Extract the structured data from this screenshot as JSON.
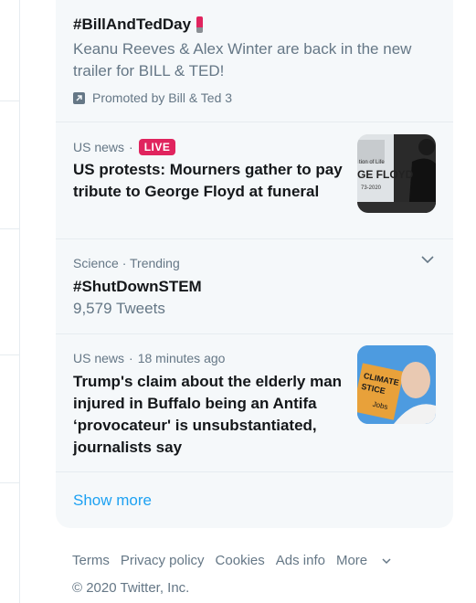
{
  "promo": {
    "title": "#BillAndTedDay",
    "description": "Keanu Reeves & Alex Winter are back in the new trailer for BILL & TED!",
    "promoted_by": "Promoted by Bill & Ted 3",
    "icon": "promoted-arrow-icon"
  },
  "news1": {
    "category": "US news",
    "separator": "·",
    "badge": "LIVE",
    "headline": "US protests: Mourners gather to pay tribute to George Floyd at funeral",
    "thumb_lines": [
      "tion of Life",
      "GE FLOYD",
      "73-2020"
    ]
  },
  "trend": {
    "context": "Science · Trending",
    "hashtag": "#ShutDownSTEM",
    "tweets": "9,579 Tweets"
  },
  "news2": {
    "category": "US news",
    "separator": "·",
    "time": "18 minutes ago",
    "headline": "Trump's claim about the elderly man injured in Buffalo being an Antifa ‘provocateur' is unsubstantiated, journalists say",
    "thumb_sign": [
      "CLIMATE",
      "STICE",
      "Jobs"
    ]
  },
  "show_more": "Show more",
  "footer": {
    "links": [
      "Terms",
      "Privacy policy",
      "Cookies",
      "Ads info",
      "More"
    ],
    "copyright": "© 2020 Twitter, Inc."
  },
  "colors": {
    "accent": "#1da1f2",
    "live": "#e0245e",
    "muted": "#657786",
    "panel": "#f5f8fa"
  }
}
